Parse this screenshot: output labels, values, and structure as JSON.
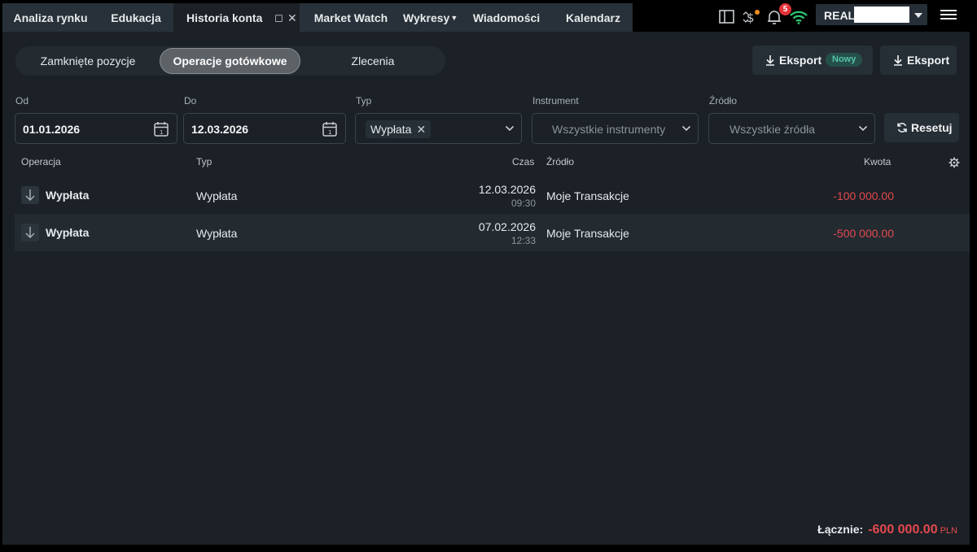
{
  "nav": {
    "tabs": [
      {
        "label": "Analiza rynku"
      },
      {
        "label": "Edukacja"
      },
      {
        "label": "Historia konta"
      },
      {
        "label": "Market Watch"
      },
      {
        "label": "Wykresy"
      },
      {
        "label": "Wiadomości"
      },
      {
        "label": "Kalendarz"
      }
    ],
    "notification_count": "5",
    "account_label": "REAL"
  },
  "segments": [
    {
      "label": "Zamknięte pozycje"
    },
    {
      "label": "Operacje gotówkowe"
    },
    {
      "label": "Zlecenia"
    }
  ],
  "export_new": {
    "label": "Eksport",
    "badge": "Nowy"
  },
  "export": {
    "label": "Eksport"
  },
  "filters": {
    "from_label": "Od",
    "from_value": "01.01.2026",
    "to_label": "Do",
    "to_value": "12.03.2026",
    "type_label": "Typ",
    "type_chip": "Wypłata",
    "instrument_label": "Instrument",
    "instrument_placeholder": "Wszystkie instrumenty",
    "source_label": "Źródło",
    "source_placeholder": "Wszystkie źródła",
    "reset_label": "Resetuj"
  },
  "table": {
    "headers": {
      "operation": "Operacja",
      "type": "Typ",
      "time": "Czas",
      "source": "Źródło",
      "amount": "Kwota"
    },
    "rows": [
      {
        "operation": "Wypłata",
        "type": "Wypłata",
        "date": "12.03.2026",
        "time": "09:30",
        "source": "Moje Transakcje",
        "amount": "-100 000.00"
      },
      {
        "operation": "Wypłata",
        "type": "Wypłata",
        "date": "07.02.2026",
        "time": "12:33",
        "source": "Moje Transakcje",
        "amount": "-500 000.00"
      }
    ]
  },
  "total": {
    "label": "Łącznie:",
    "value": "-600 000.00",
    "currency": "PLN"
  },
  "colors": {
    "background": "#1b2126",
    "negative": "#e5484f",
    "accent_badge": "#56c2a8",
    "notification": "#e5323a",
    "wifi": "#2ecc71"
  }
}
